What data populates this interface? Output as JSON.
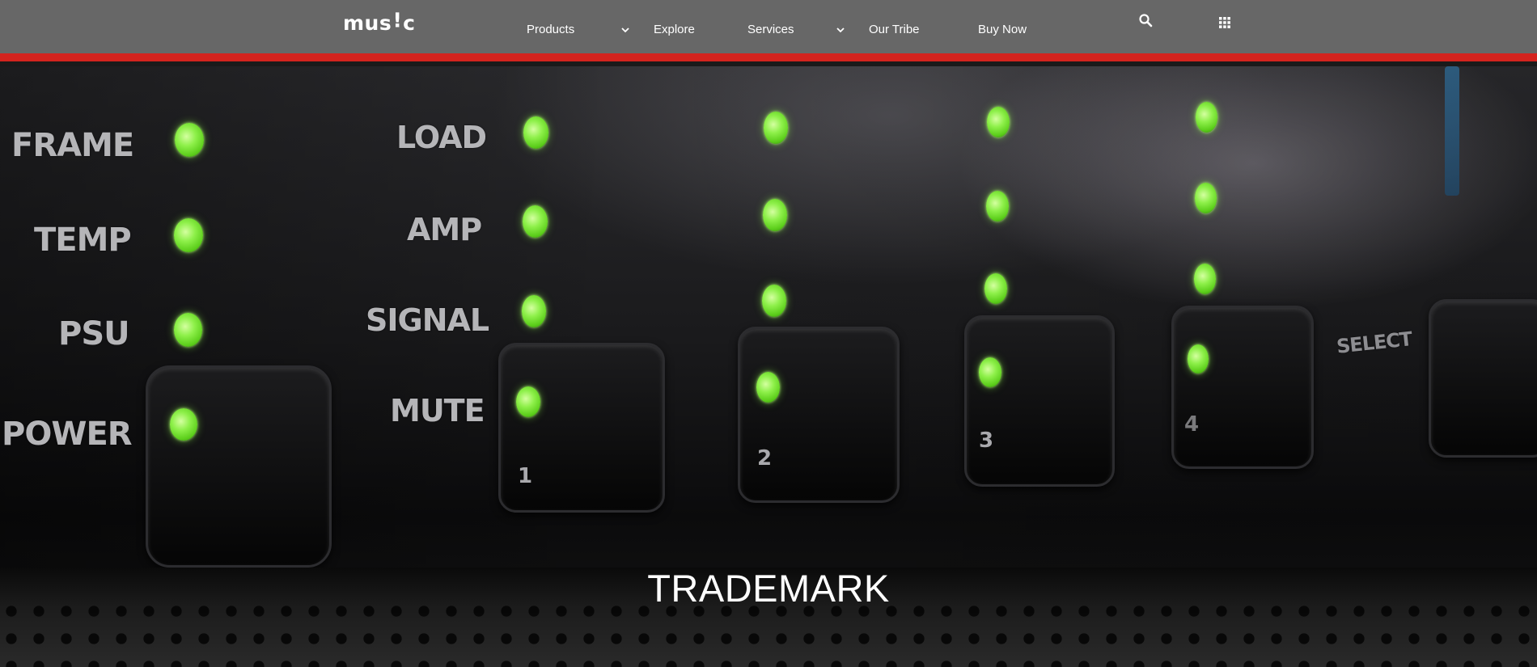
{
  "header": {
    "logo_text": "MUS!C",
    "nav_items": [
      {
        "label": "Products",
        "has_dropdown": true
      },
      {
        "label": "Explore",
        "has_dropdown": false
      },
      {
        "label": "Services",
        "has_dropdown": true
      },
      {
        "label": "Our Tribe",
        "has_dropdown": false
      },
      {
        "label": "Buy Now",
        "has_dropdown": false
      }
    ],
    "icons": [
      "search-icon",
      "apps-grid-icon"
    ],
    "colors": {
      "bar": "#676767",
      "accent": "#d4231e"
    }
  },
  "hero": {
    "title": "TRADEMARK",
    "panel_labels": {
      "frame": "FRAME",
      "temp": "TEMP",
      "psu": "PSU",
      "power": "POWER",
      "load": "LOAD",
      "amp": "AMP",
      "signal": "SIGNAL",
      "mute": "MUTE",
      "select": "SELECT"
    },
    "channel_numbers": [
      "1",
      "2",
      "3",
      "4"
    ],
    "led_color": "#8ef04a"
  }
}
